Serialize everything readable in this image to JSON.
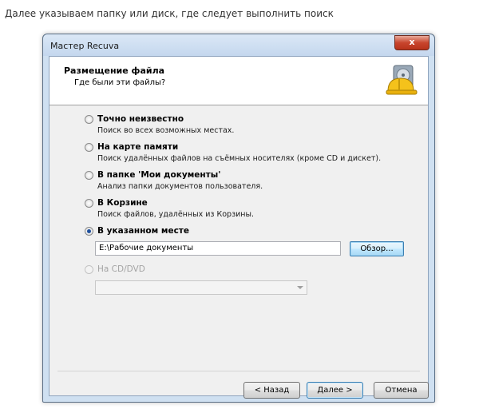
{
  "caption": "Далее указываем папку или диск, где следует выполнить поиск",
  "window": {
    "title": "Мастер Recuva",
    "close_label": "x"
  },
  "header": {
    "title": "Размещение файла",
    "subtitle": "Где были эти файлы?",
    "icon": "hard-drive-with-helmet-icon"
  },
  "options": [
    {
      "label": "Точно неизвестно",
      "desc": "Поиск во всех возможных местах.",
      "checked": false
    },
    {
      "label": "На карте памяти",
      "desc": "Поиск удалённых файлов на съёмных носителях (кроме CD и дискет).",
      "checked": false
    },
    {
      "label": "В папке 'Мои документы'",
      "desc": "Анализ папки документов пользователя.",
      "checked": false
    },
    {
      "label": "В Корзине",
      "desc": "Поиск файлов, удалённых из Корзины.",
      "checked": false
    },
    {
      "label": "В указанном месте",
      "desc": "",
      "checked": true
    },
    {
      "label": "На CD/DVD",
      "desc": "",
      "checked": false,
      "disabled": true
    }
  ],
  "path": {
    "value": "E:\\Рабочие документы",
    "browse_label": "Обзор..."
  },
  "buttons": {
    "back": "< Назад",
    "next": "Далее >",
    "cancel": "Отмена"
  },
  "colors": {
    "accent": "#3c7fb1",
    "close": "#c8452d"
  }
}
